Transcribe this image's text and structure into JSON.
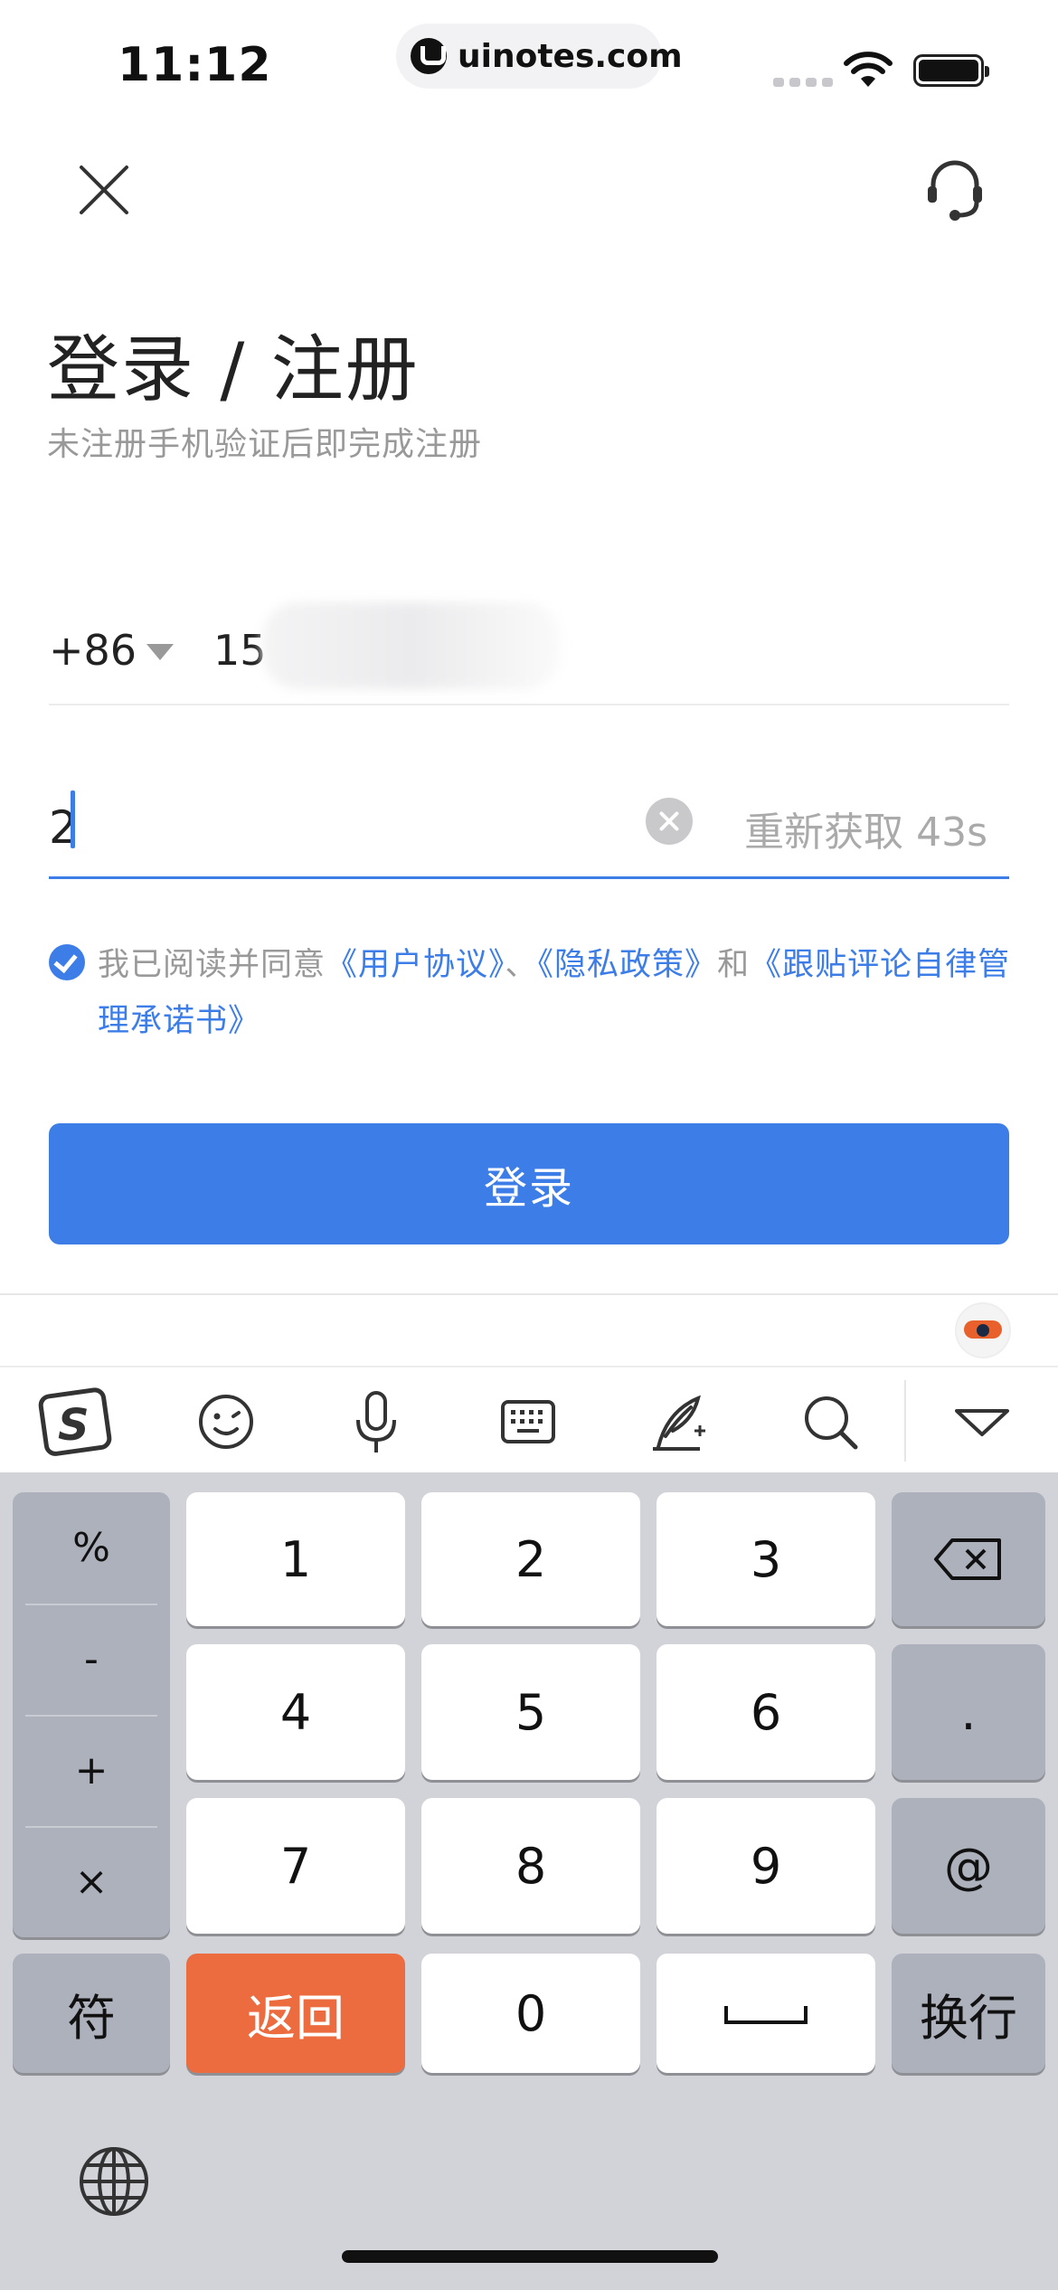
{
  "status_bar": {
    "time": "11:12",
    "url": "uinotes.com"
  },
  "header": {
    "close_icon": "close-icon",
    "support_icon": "headset-icon"
  },
  "login": {
    "title": "登录 / 注册",
    "subtitle": "未注册手机验证后即完成注册",
    "country_code": "+86",
    "phone_prefix": "15",
    "code_value": "2",
    "resend_label": "重新获取 43s",
    "agreement": {
      "checked": true,
      "prefix": "我已阅读并同意",
      "link1": "《用户协议》",
      "sep1": "、",
      "link2": "《隐私政策》",
      "sep2": "和",
      "link3": "《跟贴评论自律管理承诺书》"
    },
    "login_button": "登录"
  },
  "keyboard": {
    "toolbar_icons": [
      "sogou-logo-icon",
      "emoji-icon",
      "microphone-icon",
      "keyboard-icon",
      "quill-icon",
      "search-icon",
      "collapse-icon"
    ],
    "symbols": [
      "%",
      "-",
      "+",
      "×"
    ],
    "digits": [
      "1",
      "2",
      "3",
      "4",
      "5",
      "6",
      "7",
      "8",
      "9",
      "0"
    ],
    "dot": ".",
    "at": "@",
    "fu_label": "符",
    "back_label": "返回",
    "enter_label": "换行",
    "accent_orange": "#ec6c3f"
  },
  "colors": {
    "primary": "#3c7de8",
    "muted_text": "#999999"
  }
}
